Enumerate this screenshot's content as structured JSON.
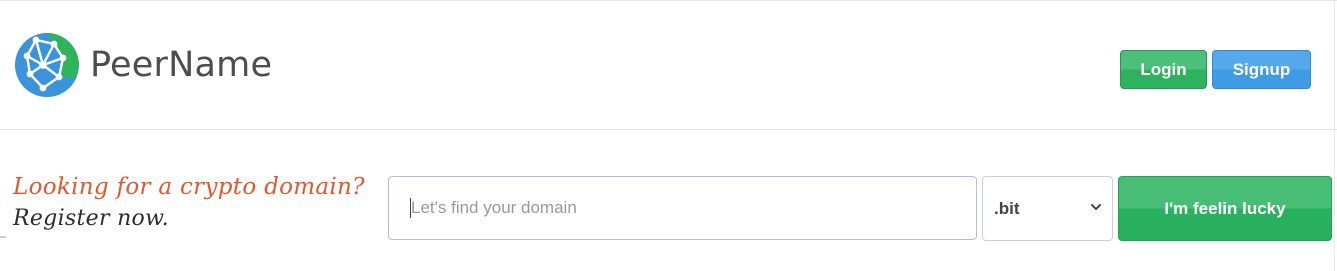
{
  "brand": {
    "name": "PeerName",
    "logo_icon": "globe-network-icon"
  },
  "auth": {
    "login_label": "Login",
    "signup_label": "Signup"
  },
  "hero": {
    "tagline_primary": "Looking for a crypto domain?",
    "tagline_secondary": "Register now."
  },
  "search": {
    "placeholder": "Let's find your domain",
    "value": "",
    "tld_selected": ".bit",
    "lucky_label": "I'm feelin lucky"
  },
  "colors": {
    "brand_text": "#4d4d4d",
    "login_green": "#2eb25f",
    "signup_blue": "#3f9be4",
    "tagline_orange": "#e2572c",
    "logo_blue": "#3b93dc",
    "logo_green": "#2fb35d"
  }
}
